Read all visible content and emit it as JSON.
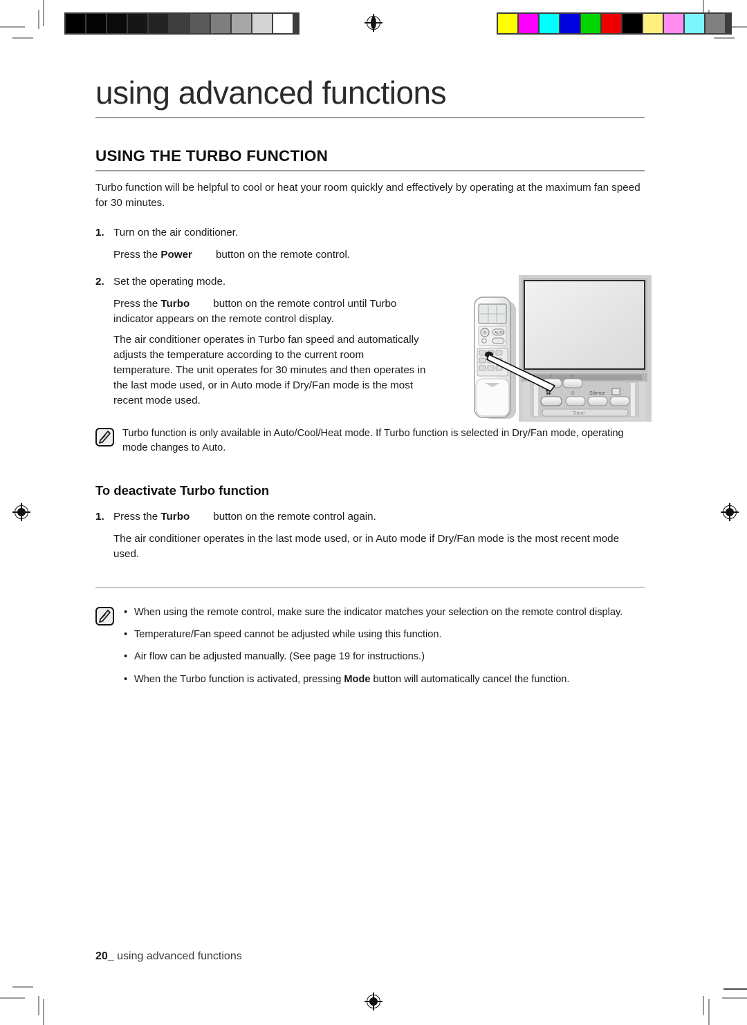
{
  "print_marks": {
    "grayscale_bar": [
      "#000000",
      "#040404",
      "#0b0b0b",
      "#161616",
      "#232323",
      "#3d3d3d",
      "#5a5a5a",
      "#7e7e7e",
      "#a6a6a6",
      "#d4d4d4",
      "#ffffff"
    ],
    "color_bar": [
      "#ffff00",
      "#ff00ff",
      "#00ffff",
      "#0000e0",
      "#00d400",
      "#ee0000",
      "#000000",
      "#ffef7f",
      "#ff8cf0",
      "#7cf5ff",
      "#808080"
    ],
    "registration_icon": "registration-target-icon"
  },
  "chapter": {
    "title": "using advanced functions"
  },
  "section": {
    "title": "USING THE TURBO FUNCTION",
    "intro": "Turbo function will be helpful to cool or heat your room quickly and effectively by operating at the maximum fan speed for 30 minutes."
  },
  "steps": [
    {
      "number": "1.",
      "text": "Turn on the air conditioner.",
      "sub": [
        {
          "pre": "Press the ",
          "bold": "Power",
          "post": "button on the remote control."
        }
      ]
    },
    {
      "number": "2.",
      "text": "Set the operating mode.",
      "sub": [
        {
          "pre": "Press the ",
          "bold": "Turbo",
          "post": "button on the remote control until Turbo indicator appears on the remote control display."
        }
      ],
      "paragraph": "The air conditioner operates in Turbo fan speed and automatically adjusts the temperature according to the current room temperature. The unit operates for 30 minutes and then operates in the last mode used, or in Auto mode if Dry/Fan mode is the most recent mode used."
    }
  ],
  "note_top": {
    "icon": "note-pen-icon",
    "text": "Turbo function is only available in Auto/Cool/Heat mode. If Turbo function is selected in Dry/Fan mode, operating mode changes to Auto."
  },
  "deactivate": {
    "heading": "To deactivate Turbo function",
    "step_number": "1.",
    "step_pre": "Press the ",
    "step_bold": "Turbo",
    "step_post": "button on the remote control again.",
    "paragraph": "The air conditioner operates in the last mode used, or in Auto mode if Dry/Fan mode is the most recent mode used."
  },
  "note_bottom": {
    "icon": "note-pen-icon",
    "bullets": [
      {
        "pre": "When using the remote control, make sure the indicator matches your selection on the remote control display.",
        "bold": "",
        "post": ""
      },
      {
        "pre": "Temperature/Fan speed cannot be adjusted while using this function.",
        "bold": "",
        "post": ""
      },
      {
        "pre": "Air flow can be adjusted manually. (See page 19 for instructions.)",
        "bold": "",
        "post": ""
      },
      {
        "pre": "When the Turbo function is activated, pressing ",
        "bold": "Mode",
        "post": " button will automatically cancel the function."
      }
    ]
  },
  "illustration": {
    "alt": "remote-control-and-air-conditioner-panel",
    "panel_labels": [
      "Silence",
      "Timer"
    ]
  },
  "footer": {
    "page_number": "20",
    "separator": "_",
    "label": "using advanced functions"
  }
}
